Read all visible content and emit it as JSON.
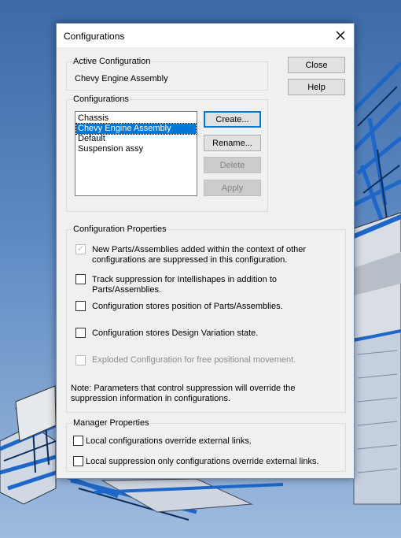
{
  "colors": {
    "accent": "#0078d7",
    "dialog_bg": "#f0f0f0",
    "disabled_text": "#8d8d8d"
  },
  "dialog": {
    "title": "Configurations",
    "close_icon": "close-icon"
  },
  "active_configuration": {
    "group_title": "Active Configuration",
    "value": "Chevy Engine Assembly"
  },
  "configurations": {
    "group_title": "Configurations",
    "items": [
      {
        "label": "Chassis",
        "selected": false
      },
      {
        "label": "Chevy Engine Assembly",
        "selected": true
      },
      {
        "label": "Default",
        "selected": false
      },
      {
        "label": "Suspension assy",
        "selected": false
      }
    ],
    "buttons": {
      "create": "Create...",
      "rename": "Rename...",
      "delete": "Delete",
      "apply": "Apply"
    }
  },
  "side_buttons": {
    "close": "Close",
    "help": "Help"
  },
  "configuration_properties": {
    "group_title": "Configuration Properties",
    "options": [
      {
        "line1": "New Parts/Assemblies added within the context of other",
        "line2": "configurations are suppressed in this configuration.",
        "checked": true,
        "enabled": false
      },
      {
        "line1": "Track suppression for Intellishapes in addition to",
        "line2": "Parts/Assemblies.",
        "checked": false,
        "enabled": true
      },
      {
        "line1": "Configuration stores position of Parts/Assemblies.",
        "line2": "",
        "checked": false,
        "enabled": true
      },
      {
        "line1": "Configuration stores Design Variation state.",
        "line2": "",
        "checked": false,
        "enabled": true
      },
      {
        "line1": "Exploded Configuration for free positional movement.",
        "line2": "",
        "checked": false,
        "enabled": false
      }
    ],
    "note_line1": "Note: Parameters that control suppression will override the",
    "note_line2": "suppression information in configurations."
  },
  "manager_properties": {
    "group_title": "Manager Properties",
    "options": [
      {
        "label": "Local configurations override external links.",
        "checked": false
      },
      {
        "label": "Local suppression only configurations override external links.",
        "checked": false
      }
    ]
  }
}
